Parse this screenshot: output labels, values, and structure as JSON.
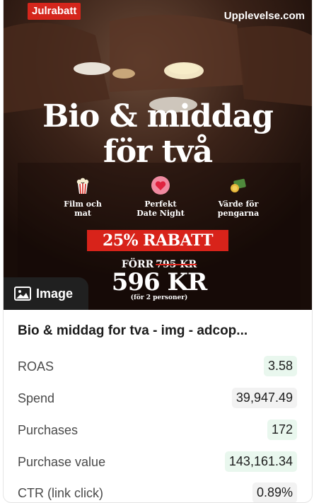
{
  "creative": {
    "badge": "Julrabatt",
    "brand": "Upplevelse.com",
    "headline_line1": "Bio & middag",
    "headline_line2": "för två",
    "features": [
      {
        "label": "Film och\nmat",
        "icon": "popcorn-icon"
      },
      {
        "label": "Perfekt\nDate Night",
        "icon": "heart-icon"
      },
      {
        "label": "Värde för\npengarna",
        "icon": "money-icon"
      }
    ],
    "discount": "25% RABATT",
    "before_label": "FÖRR",
    "old_price": "795 KR",
    "price": "596 KR",
    "per_persons": "(för 2 personer)"
  },
  "type_tag": {
    "label": "Image",
    "icon": "image-icon"
  },
  "ad_title": "Bio & middag for tva - img - adcop...",
  "metrics": [
    {
      "label": "ROAS",
      "value": "3.58",
      "bg": "#e9f7ee"
    },
    {
      "label": "Spend",
      "value": "39,947.49",
      "bg": "#f2f2f2"
    },
    {
      "label": "Purchases",
      "value": "172",
      "bg": "#e9f7ee"
    },
    {
      "label": "Purchase value",
      "value": "143,161.34",
      "bg": "#e9f7ee"
    },
    {
      "label": "CTR (link click)",
      "value": "0.89%",
      "bg": "#f2f2f2"
    }
  ],
  "colors": {
    "accent_red": "#d5261c",
    "positive_bg": "#e9f7ee",
    "neutral_bg": "#f2f2f2"
  }
}
